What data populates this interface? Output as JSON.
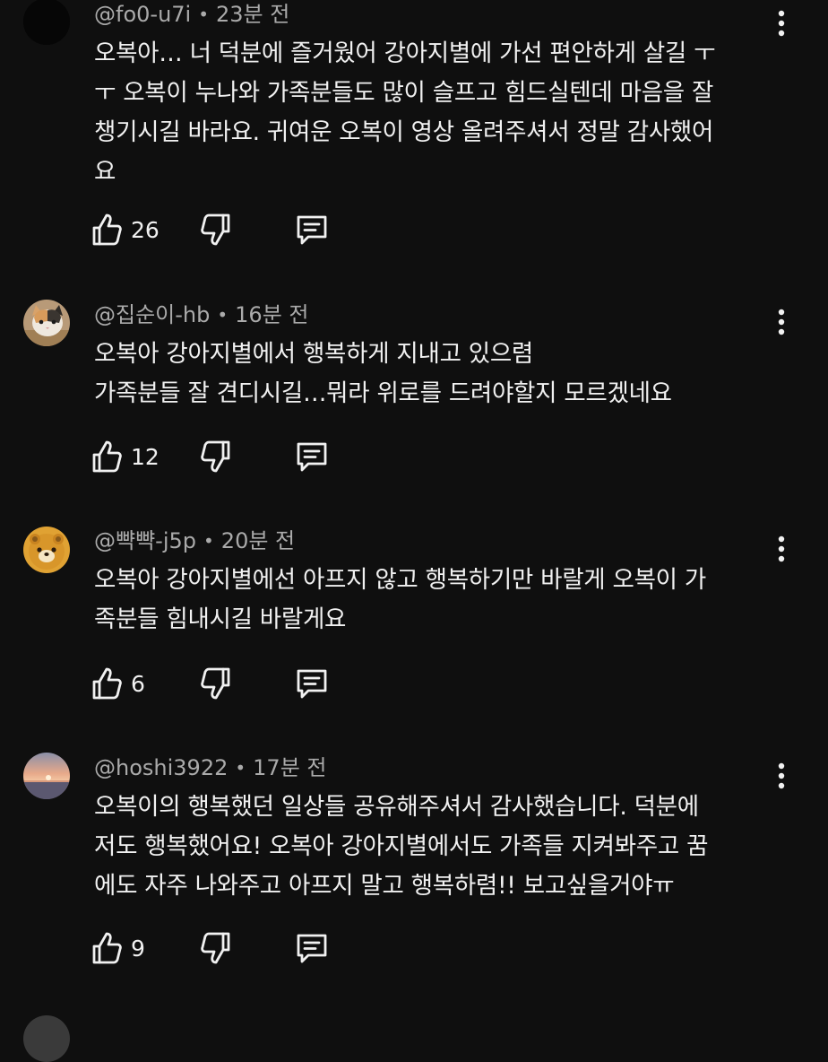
{
  "comments": [
    {
      "handle": "@fo0-u7i",
      "time": "23분 전",
      "lines": [
        "오복아… 너 덕분에 즐거웠어 강아지별에 가선 편안하게 살길 ㅜ",
        "ㅜ 오복이 누나와 가족분들도 많이 슬프고 힘드실텐데 마음을 잘",
        "챙기시길 바라요. 귀여운 오복이 영상 올려주셔서 정말 감사했어",
        "요"
      ],
      "likes": "26",
      "avatar_icon": "dark-avatar-icon"
    },
    {
      "handle": "@집순이-hb",
      "time": "16분 전",
      "lines": [
        "오복아 강아지별에서 행복하게 지내고 있으렴",
        "가족분들 잘 견디시길…뭐라 위로를 드려야할지 모르겠네요"
      ],
      "likes": "12",
      "avatar_icon": "cat-avatar-icon"
    },
    {
      "handle": "@뺙뺙-j5p",
      "time": "20분 전",
      "lines": [
        "오복아 강아지별에선 아프지 않고 행복하기만 바랄게 오복이 가",
        "족분들 힘내시길 바랄게요"
      ],
      "likes": "6",
      "avatar_icon": "bear-avatar-icon"
    },
    {
      "handle": "@hoshi3922",
      "time": "17분 전",
      "lines": [
        "오복이의 행복했던 일상들 공유해주셔서 감사했습니다. 덕분에",
        "저도 행복했어요! 오복아 강아지별에서도 가족들 지켜봐주고 꿈",
        "에도 자주 나와주고 아프지 말고 행복하렴!! 보고싶을거야ㅠ"
      ],
      "likes": "9",
      "avatar_icon": "sunset-avatar-icon"
    }
  ],
  "colors": {
    "background": "#0f0f0f",
    "text_primary": "#f1f1f1",
    "text_secondary": "#aaaaaa"
  }
}
